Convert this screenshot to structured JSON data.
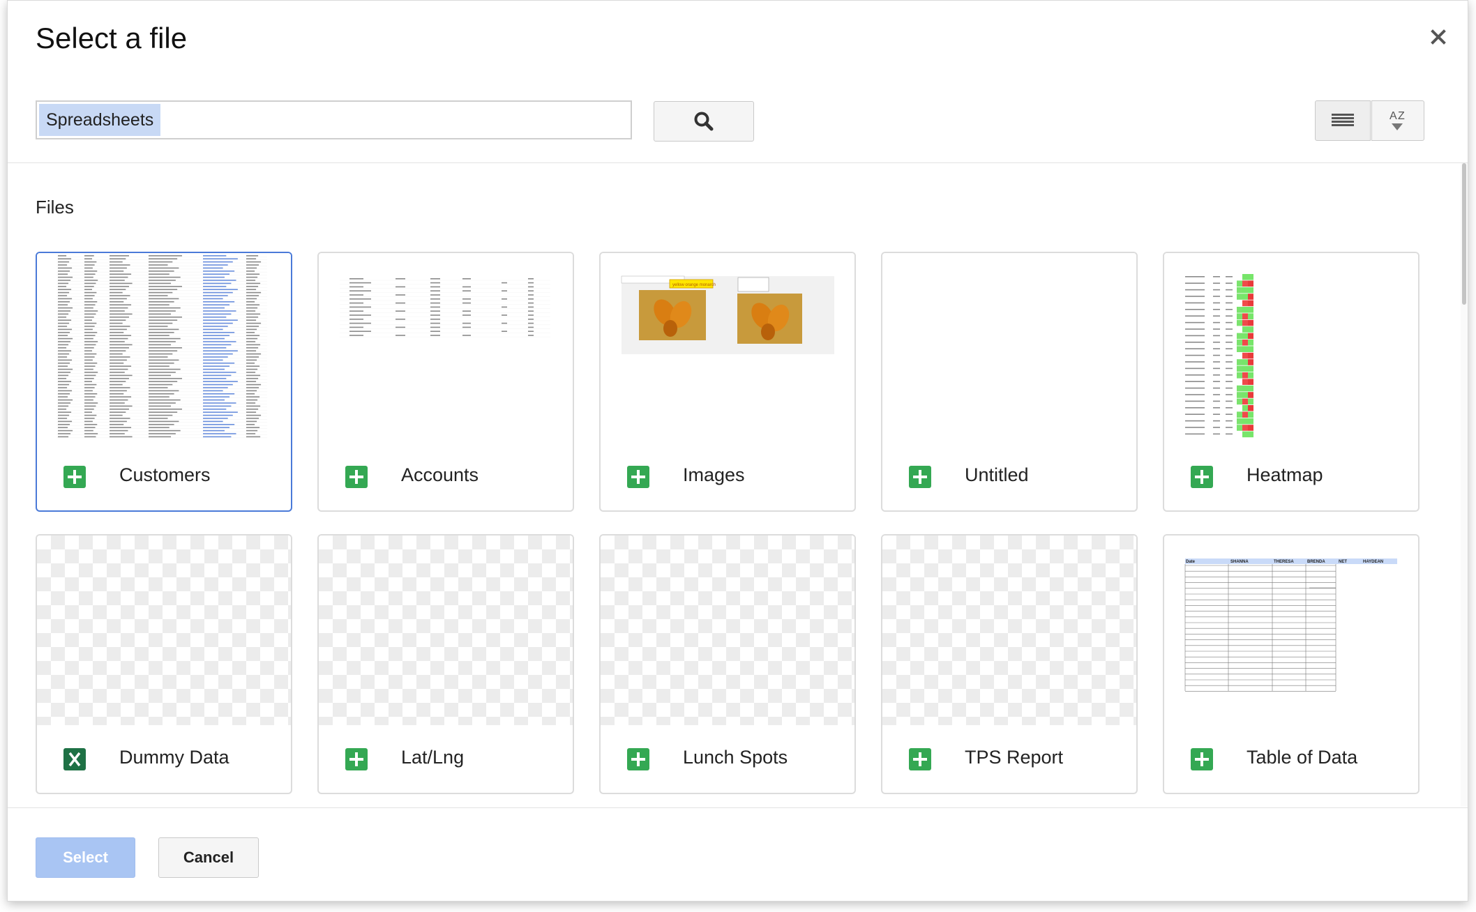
{
  "dialog": {
    "title": "Select a file",
    "close_icon": "close-icon"
  },
  "search": {
    "token": "Spreadsheets",
    "button_icon": "search-icon"
  },
  "view_controls": {
    "list_icon": "list-view-icon",
    "sort_icon": "sort-az-icon"
  },
  "section": {
    "label": "Files"
  },
  "files": [
    {
      "name": "Customers",
      "icon": "google-sheets-icon",
      "thumbnail": "spreadsheet-preview",
      "selected": true
    },
    {
      "name": "Accounts",
      "icon": "google-sheets-icon",
      "thumbnail": "spreadsheet-preview",
      "selected": false
    },
    {
      "name": "Images",
      "icon": "google-sheets-icon",
      "thumbnail": "image-preview",
      "selected": false
    },
    {
      "name": "Untitled",
      "icon": "google-sheets-icon",
      "thumbnail": "blank",
      "selected": false
    },
    {
      "name": "Heatmap",
      "icon": "google-sheets-icon",
      "thumbnail": "heatmap-preview",
      "selected": false
    },
    {
      "name": "Dummy Data",
      "icon": "excel-icon",
      "thumbnail": "checker",
      "selected": false
    },
    {
      "name": "Lat/Lng",
      "icon": "google-sheets-icon",
      "thumbnail": "checker",
      "selected": false
    },
    {
      "name": "Lunch Spots",
      "icon": "google-sheets-icon",
      "thumbnail": "checker",
      "selected": false
    },
    {
      "name": "TPS Report",
      "icon": "google-sheets-icon",
      "thumbnail": "checker",
      "selected": false
    },
    {
      "name": "Table of Data",
      "icon": "google-sheets-icon",
      "thumbnail": "table-preview",
      "selected": false
    }
  ],
  "previews": {
    "images_caption": "yellow orange monarch",
    "table_headers": [
      "Date",
      "SHANNA",
      "THERESA",
      "BRENDA",
      "NET",
      "HAYDEAN"
    ]
  },
  "footer": {
    "select_label": "Select",
    "cancel_label": "Cancel"
  },
  "colors": {
    "accent": "#4a7ad8",
    "sheets_green": "#34a853",
    "excel_green": "#1e7145",
    "select_disabled": "#a9c5f3",
    "search_token_bg": "#c8d9f5"
  }
}
